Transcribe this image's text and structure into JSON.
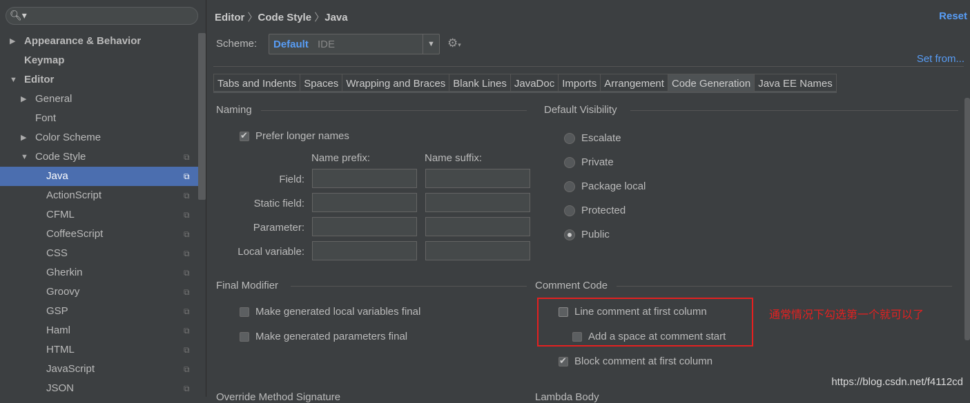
{
  "sidebar": {
    "search_icon": "search-icon",
    "items": [
      {
        "label": "Appearance & Behavior",
        "level": 0,
        "arrow": "▶",
        "bold": true
      },
      {
        "label": "Keymap",
        "level": 0,
        "arrow": "",
        "bold": true
      },
      {
        "label": "Editor",
        "level": 0,
        "arrow": "▼",
        "bold": true
      },
      {
        "label": "General",
        "level": 1,
        "arrow": "▶"
      },
      {
        "label": "Font",
        "level": 1,
        "arrow": ""
      },
      {
        "label": "Color Scheme",
        "level": 1,
        "arrow": "▶"
      },
      {
        "label": "Code Style",
        "level": 1,
        "arrow": "▼",
        "copy": true
      },
      {
        "label": "Java",
        "level": 2,
        "selected": true,
        "copy": true
      },
      {
        "label": "ActionScript",
        "level": 2,
        "copy": true
      },
      {
        "label": "CFML",
        "level": 2,
        "copy": true
      },
      {
        "label": "CoffeeScript",
        "level": 2,
        "copy": true
      },
      {
        "label": "CSS",
        "level": 2,
        "copy": true
      },
      {
        "label": "Gherkin",
        "level": 2,
        "copy": true
      },
      {
        "label": "Groovy",
        "level": 2,
        "copy": true
      },
      {
        "label": "GSP",
        "level": 2,
        "copy": true
      },
      {
        "label": "Haml",
        "level": 2,
        "copy": true
      },
      {
        "label": "HTML",
        "level": 2,
        "copy": true
      },
      {
        "label": "JavaScript",
        "level": 2,
        "copy": true
      },
      {
        "label": "JSON",
        "level": 2,
        "copy": true
      }
    ]
  },
  "breadcrumb": [
    "Editor",
    "Code Style",
    "Java"
  ],
  "reset": "Reset",
  "scheme": {
    "label": "Scheme:",
    "value": "Default",
    "type": "IDE"
  },
  "set_from": "Set from...",
  "tabs": [
    "Tabs and Indents",
    "Spaces",
    "Wrapping and Braces",
    "Blank Lines",
    "JavaDoc",
    "Imports",
    "Arrangement",
    "Code Generation",
    "Java EE Names"
  ],
  "active_tab": "Code Generation",
  "naming": {
    "title": "Naming",
    "prefer_longer": "Prefer longer names",
    "prefix_header": "Name prefix:",
    "suffix_header": "Name suffix:",
    "rows": [
      "Field:",
      "Static field:",
      "Parameter:",
      "Local variable:"
    ]
  },
  "visibility": {
    "title": "Default Visibility",
    "options": [
      "Escalate",
      "Private",
      "Package local",
      "Protected",
      "Public"
    ],
    "selected": "Public"
  },
  "final_modifier": {
    "title": "Final Modifier",
    "items": [
      "Make generated local variables final",
      "Make generated parameters final"
    ]
  },
  "comment_code": {
    "title": "Comment Code",
    "line_first": "Line comment at first column",
    "add_space": "Add a space at comment start",
    "block_first": "Block comment at first column"
  },
  "bottom": {
    "override": "Override Method Signature",
    "lambda": "Lambda Body"
  },
  "annotation": "通常情况下勾选第一个就可以了",
  "watermark": "https://blog.csdn.net/f4112cd"
}
